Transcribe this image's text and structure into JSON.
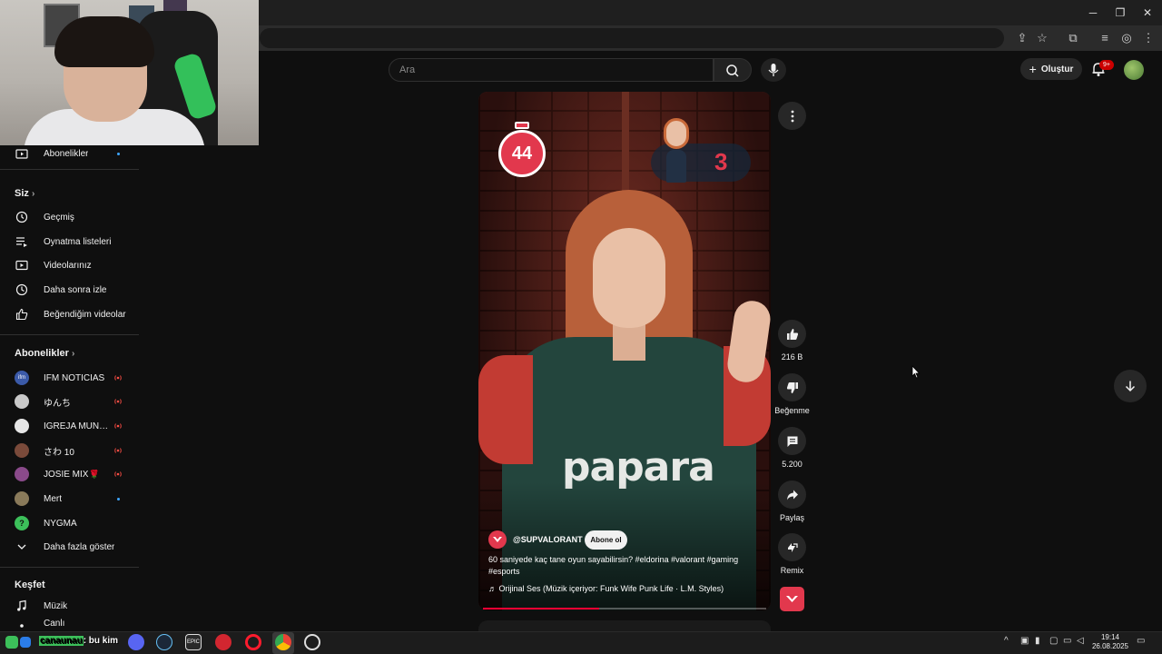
{
  "search": {
    "placeholder": "Ara"
  },
  "header": {
    "create_label": "Oluştur",
    "notif_count": "9+"
  },
  "sidebar": {
    "subscriptions_link": "Abonelikler",
    "you_header": "Siz",
    "you_items": [
      {
        "label": "Geçmiş",
        "icon": "history-icon"
      },
      {
        "label": "Oynatma listeleri",
        "icon": "playlist-icon"
      },
      {
        "label": "Videolarınız",
        "icon": "your-videos-icon"
      },
      {
        "label": "Daha sonra izle",
        "icon": "watch-later-icon"
      },
      {
        "label": "Beğendiğim videolar",
        "icon": "liked-icon"
      }
    ],
    "subs_header": "Abonelikler",
    "channels": [
      {
        "name": "IFM NOTICIAS",
        "status": "live",
        "color": "#3b5aa8"
      },
      {
        "name": "ゆんち",
        "status": "live",
        "color": "#c9c9c9"
      },
      {
        "name": "IGREJA MUNDIA...",
        "status": "live",
        "color": "#e6e6e6"
      },
      {
        "name": "さわ 10",
        "status": "live",
        "color": "#7a4a3a"
      },
      {
        "name": "JOSIE MIX🌹",
        "status": "live",
        "color": "#8a4a8a"
      },
      {
        "name": "Mert",
        "status": "new",
        "color": "#8a7a5a"
      },
      {
        "name": "NYGMA",
        "status": "none",
        "color": "#3cc05a"
      }
    ],
    "show_more": "Daha fazla göster",
    "explore_header": "Keşfet",
    "explore_items": [
      {
        "label": "Müzik",
        "icon": "music-icon"
      },
      {
        "label": "Canlı",
        "icon": "live-icon"
      }
    ]
  },
  "short": {
    "timer": "44",
    "score": "3",
    "jersey_text": "papara",
    "channel": "@SUPVALORANT",
    "subscribe": "Abone ol",
    "description": "60 saniyede kaç tane oyun sayabilirsin? #eldorina #valorant #gaming #esports",
    "audio": "Orijinal Ses (Müzik içeriyor: Funk Wife Punk Life · L.M. Styles)",
    "progress": 0.41
  },
  "actions": {
    "like_count": "216 B",
    "dislike_label": "Beğenme",
    "comment_count": "5.200",
    "share_label": "Paylaş",
    "remix_label": "Remix"
  },
  "taskbar": {
    "overlay_text_a": "canaunau",
    "overlay_text_b": ": bu kim",
    "time": "19:14",
    "date": "26.08.2025"
  },
  "colors": {
    "accent": "#ff0033",
    "brand_red": "#e2384d",
    "link": "#3ea6ff"
  }
}
